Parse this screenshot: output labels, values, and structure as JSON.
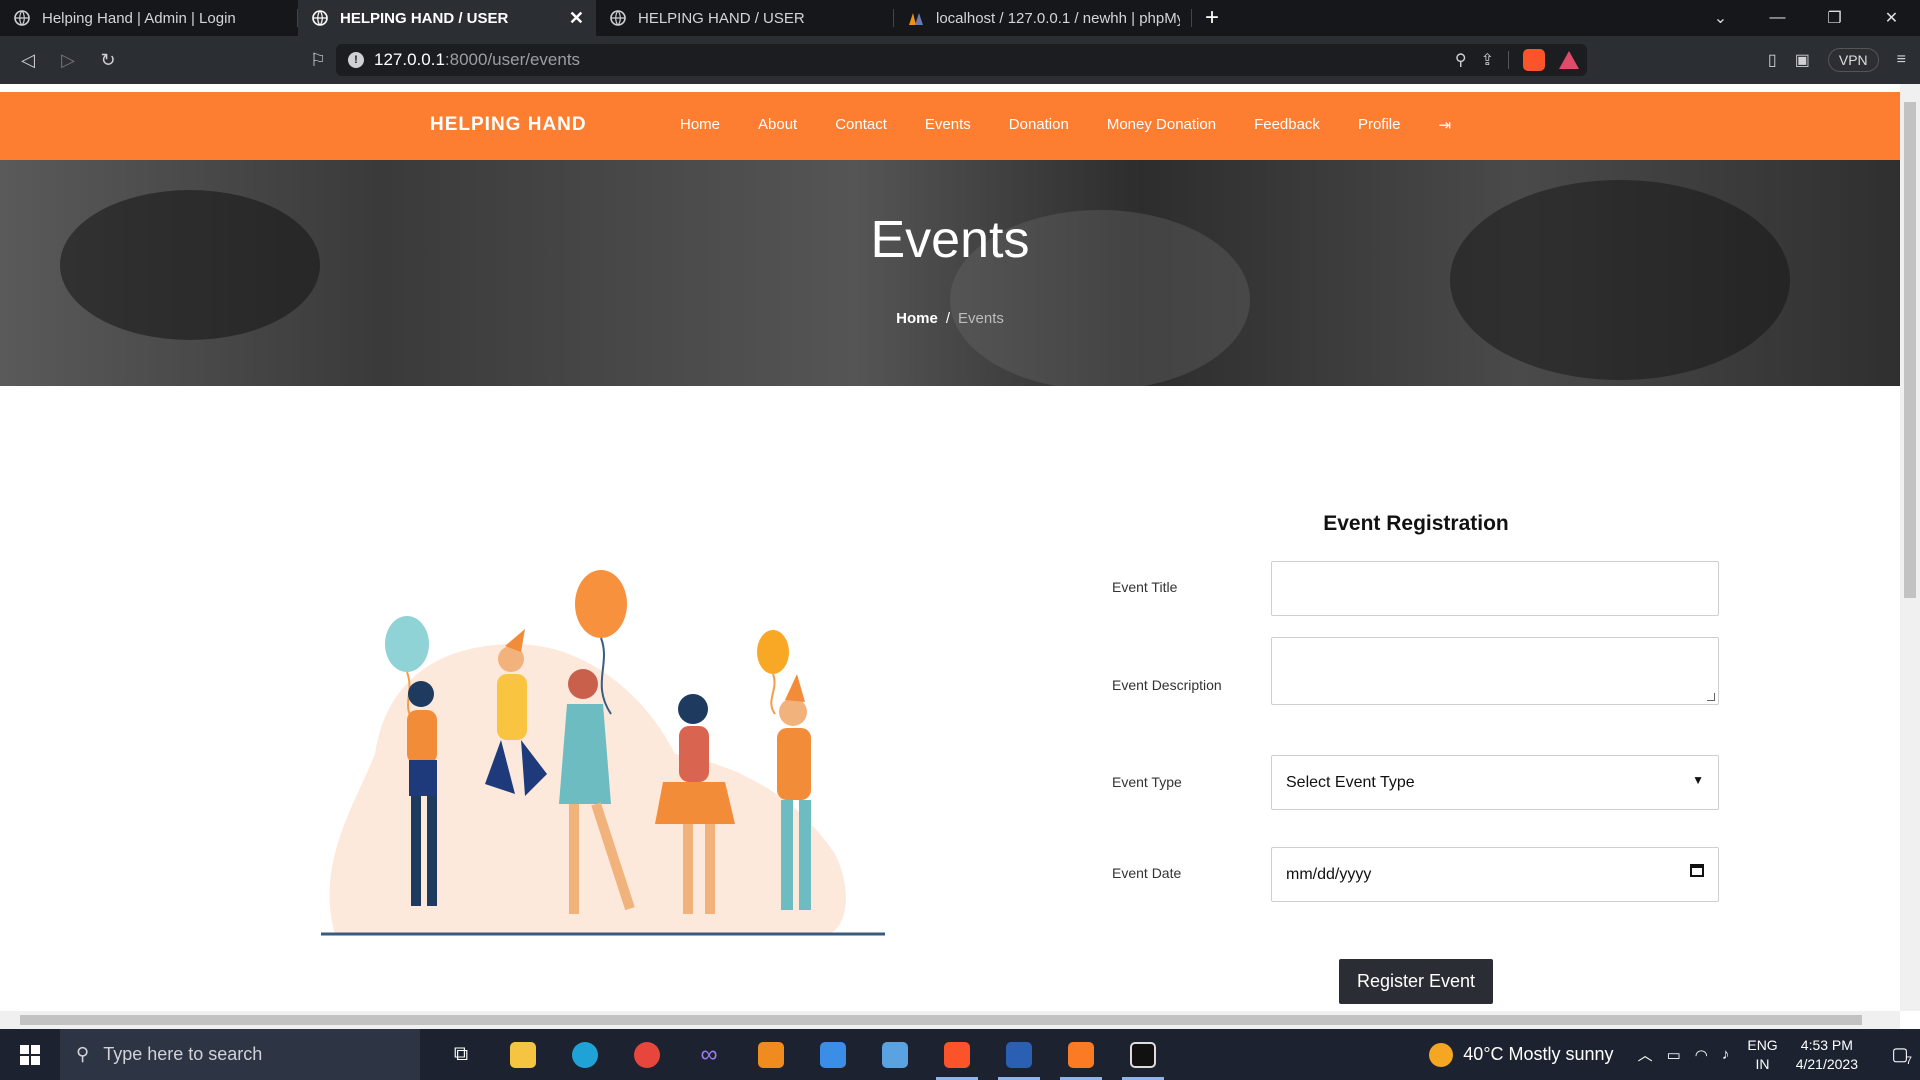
{
  "browser": {
    "tabs": [
      {
        "title": "Helping Hand | Admin | Login",
        "active": false
      },
      {
        "title": "HELPING HAND / USER",
        "active": true
      },
      {
        "title": "HELPING HAND / USER",
        "active": false
      },
      {
        "title": "localhost / 127.0.0.1 / newhh | phpMy",
        "active": false
      }
    ],
    "url_host": "127.0.0.1",
    "url_rest": ":8000/user/events",
    "vpn_label": "VPN",
    "brave_badge": "1"
  },
  "site": {
    "brand": "HELPING HAND",
    "menu": [
      "Home",
      "About",
      "Contact",
      "Events",
      "Donation",
      "Money Donation",
      "Feedback",
      "Profile"
    ],
    "logout_icon": "sign-out-icon",
    "accent": "#fd7e31"
  },
  "hero": {
    "title": "Events",
    "crumb_home": "Home",
    "crumb_sep": "/",
    "crumb_current": "Events"
  },
  "form": {
    "title": "Event Registration",
    "title_label": "Event Title",
    "title_value": "",
    "description_label": "Event Description",
    "description_value": "",
    "type_label": "Event Type",
    "type_selected": "Select Event Type",
    "date_label": "Event Date",
    "date_placeholder": "mm/dd/yyyy",
    "submit_label": "Register Event"
  },
  "taskbar": {
    "search_placeholder": "Type here to search",
    "weather": "40°C  Mostly sunny",
    "lang_1": "ENG",
    "lang_2": "IN",
    "time": "4:53 PM",
    "date": "4/21/2023",
    "notif_count": "7"
  }
}
